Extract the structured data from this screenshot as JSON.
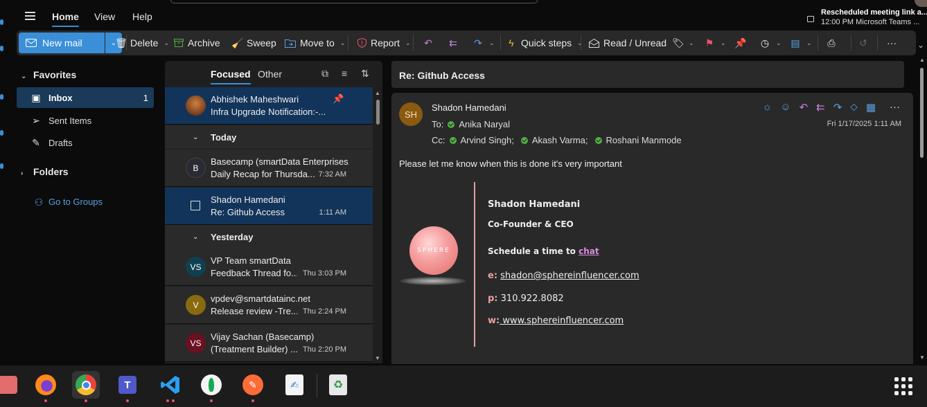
{
  "topbar": {
    "tabs": [
      "Home",
      "View",
      "Help"
    ],
    "notification": {
      "title": "Rescheduled meeting link a...",
      "subtitle": "12:00 PM  Microsoft Teams ..."
    }
  },
  "ribbon": {
    "new_mail": "New mail",
    "delete": "Delete",
    "archive": "Archive",
    "sweep": "Sweep",
    "move_to": "Move to",
    "report": "Report",
    "quick_steps": "Quick steps",
    "read_unread": "Read / Unread",
    "more": "···"
  },
  "nav": {
    "favorites": "Favorites",
    "items": [
      {
        "label": "Inbox",
        "count": "1"
      },
      {
        "label": "Sent Items",
        "count": ""
      },
      {
        "label": "Drafts",
        "count": ""
      }
    ],
    "folders": "Folders",
    "groups": "Go to Groups"
  },
  "list": {
    "tabs": [
      "Focused",
      "Other"
    ],
    "pinned": {
      "from": "Abhishek Maheshwari",
      "subject": "Infra Upgrade Notification:-..."
    },
    "groups": [
      "Today",
      "Yesterday"
    ],
    "today": [
      {
        "initials": "B",
        "from": "Basecamp (smartData Enterprises...",
        "subject": "Daily Recap for Thursda...",
        "time": "7:32 AM",
        "color": "#2a2a33"
      },
      {
        "initials": "",
        "from": "Shadon Hamedani",
        "subject": "Re: Github Access",
        "time": "1:11 AM",
        "color": ""
      }
    ],
    "yesterday": [
      {
        "initials": "VS",
        "from": "VP Team smartData",
        "subject": "Feedback Thread fo...",
        "time": "Thu 3:03 PM",
        "color": "#0f4050"
      },
      {
        "initials": "V",
        "from": "vpdev@smartdatainc.net",
        "subject": "Release review -Tre...",
        "time": "Thu 2:24 PM",
        "color": "#8a6a10"
      },
      {
        "initials": "VS",
        "from": "Vijay Sachan (Basecamp)",
        "subject": "(Treatment Builder) ...",
        "time": "Thu 2:20 PM",
        "color": "#6a1020"
      }
    ]
  },
  "reading": {
    "subject": "Re: Github Access",
    "avatar": "SH",
    "sender": "Shadon Hamedani",
    "to_label": "To:",
    "to": [
      "Anika Naryal"
    ],
    "cc_label": "Cc:",
    "cc": [
      "Arvind Singh;",
      "Akash Varma;",
      "Roshani Manmode"
    ],
    "date": "Fri 1/17/2025 1:11 AM",
    "body": "Please let me know when this is done it's very important",
    "signature": {
      "logo_text": "SPHERE",
      "name": "Shadon Hamedani",
      "title": "Co-Founder & CEO",
      "schedule_prefix": "Schedule a time to ",
      "schedule_link": "chat",
      "email_label": "e:",
      "email": "shadon@sphereinfluencer.com",
      "phone_label": "p:",
      "phone": "310.922.8082",
      "web_label": "w:",
      "web": " www.sphereinfluencer.com"
    }
  },
  "colors": {
    "accent": "#3a8fd8",
    "selected": "#12345a",
    "presence": "#52b043",
    "signature_accent": "#e8a0a0"
  }
}
